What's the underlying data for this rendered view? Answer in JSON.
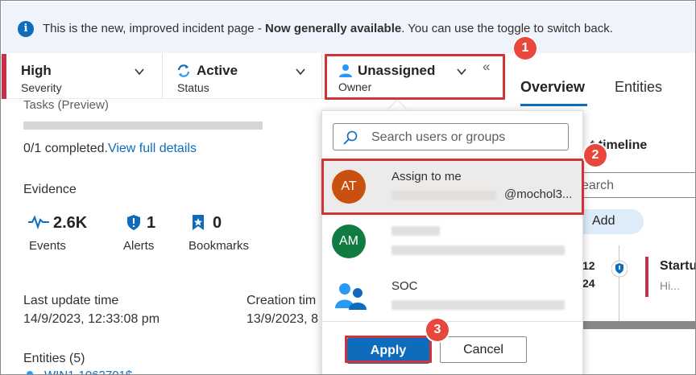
{
  "banner": {
    "text_before": "This is the new, improved incident page - ",
    "text_bold": "Now generally available",
    "text_after": ". You can use the toggle to switch back."
  },
  "header": {
    "severity": {
      "value": "High",
      "label": "Severity"
    },
    "status": {
      "value": "Active",
      "label": "Status"
    },
    "owner": {
      "value": "Unassigned",
      "label": "Owner"
    },
    "collapse_glyph": "«"
  },
  "right_panel": {
    "tabs": [
      "Overview",
      "Entities"
    ],
    "timeline_partial": "t timeline",
    "search_partial": "earch",
    "add_label": "Add",
    "date_partial_1": "12",
    "date_partial_2": "24",
    "event_title_partial": "Startu",
    "event_sub_partial": "Hi..."
  },
  "left": {
    "tasks_label": "Tasks (Preview)",
    "tasks_progress": 0,
    "completed_text": "0/1 completed.",
    "view_details": "View full details",
    "evidence_label": "Evidence",
    "stats": [
      {
        "value": "2.6K",
        "label": "Events",
        "icon": "pulse-icon"
      },
      {
        "value": "1",
        "label": "Alerts",
        "icon": "shield-icon"
      },
      {
        "value": "0",
        "label": "Bookmarks",
        "icon": "bookmark-icon"
      }
    ],
    "last_update_label": "Last update time",
    "last_update_value": "14/9/2023, 12:33:08 pm",
    "creation_label": "Creation tim",
    "creation_value": "13/9/2023, 8",
    "entities_label": "Entities (5)",
    "entity_partial": "WIN1-1062701$"
  },
  "owner_dropdown": {
    "search_placeholder": "Search users or groups",
    "items": [
      {
        "initials": "AT",
        "name": "Assign to me",
        "email_suffix": "@mochol3...",
        "color": "#ca5010"
      },
      {
        "initials": "AM",
        "name": "",
        "color": "#107c41"
      },
      {
        "initials": "",
        "name": "SOC",
        "color": "#0f6cbd"
      }
    ],
    "apply_label": "Apply",
    "cancel_label": "Cancel"
  },
  "callouts": [
    "1",
    "2",
    "3"
  ],
  "colors": {
    "accent": "#0f6cbd",
    "highlight": "#d13438",
    "severity": "#c4314b"
  }
}
